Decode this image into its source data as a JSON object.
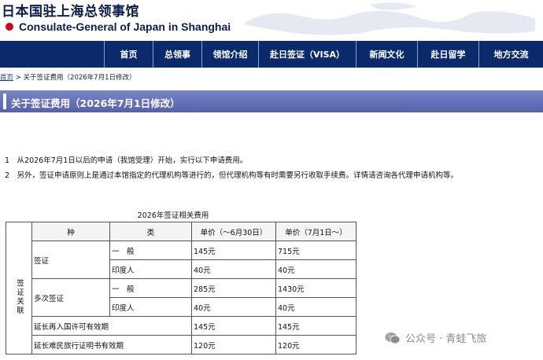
{
  "header": {
    "title_cn": "日本国驻上海总领事馆",
    "title_en": "Consulate-General of Japan in Shanghai"
  },
  "nav": {
    "items": [
      "首页",
      "总领事",
      "领馆介绍",
      "赴日签证（VISA）",
      "新闻文化",
      "赴日留学",
      "地方交流"
    ]
  },
  "breadcrumb": {
    "home": "首页",
    "sep": " > ",
    "current": "关于签证费用（2026年7月1日修改）"
  },
  "page_title": "关于签证费用（2026年7月1日修改）",
  "notes": [
    "1　从2026年7月1日以后的申请（我馆受理）开始，实行以下申请费用。",
    "2　另外，签证申请原则上是通过本馆指定的代理机构等进行的，但代理机构等有时需要另行收取手续费。详情请咨询各代理申请机构等。"
  ],
  "table": {
    "caption": "2026年签证相关费用",
    "headers": {
      "kind": "种",
      "type": "类",
      "price_before": "单价（～6月30日）",
      "price_after": "单价（7月1日～）"
    },
    "side_label": "签证关联",
    "rows": {
      "visa_general": {
        "cat": "签证",
        "sub": "一　般",
        "before": "145元",
        "after": "715元"
      },
      "visa_indian": {
        "sub": "印度人",
        "before": "40元",
        "after": "40元"
      },
      "multi_general": {
        "cat": "多次签证",
        "sub": "一　般",
        "before": "285元",
        "after": "1430元"
      },
      "multi_indian": {
        "sub": "印度人",
        "before": "40元",
        "after": "40元"
      },
      "reentry": {
        "cat": "延长再入国许可有效期",
        "before": "145元",
        "after": "145元"
      },
      "refugee": {
        "cat": "延长难民旅行证明书有效期",
        "before": "120元",
        "after": "120元"
      }
    }
  },
  "watermark": {
    "text": "公众号 · 青蛙飞旅"
  },
  "colors": {
    "nav_bg": "#0b2a6b",
    "title_bar": "#6b76bb",
    "flag_red": "#d7001b",
    "brand": "#0a1d4f"
  }
}
